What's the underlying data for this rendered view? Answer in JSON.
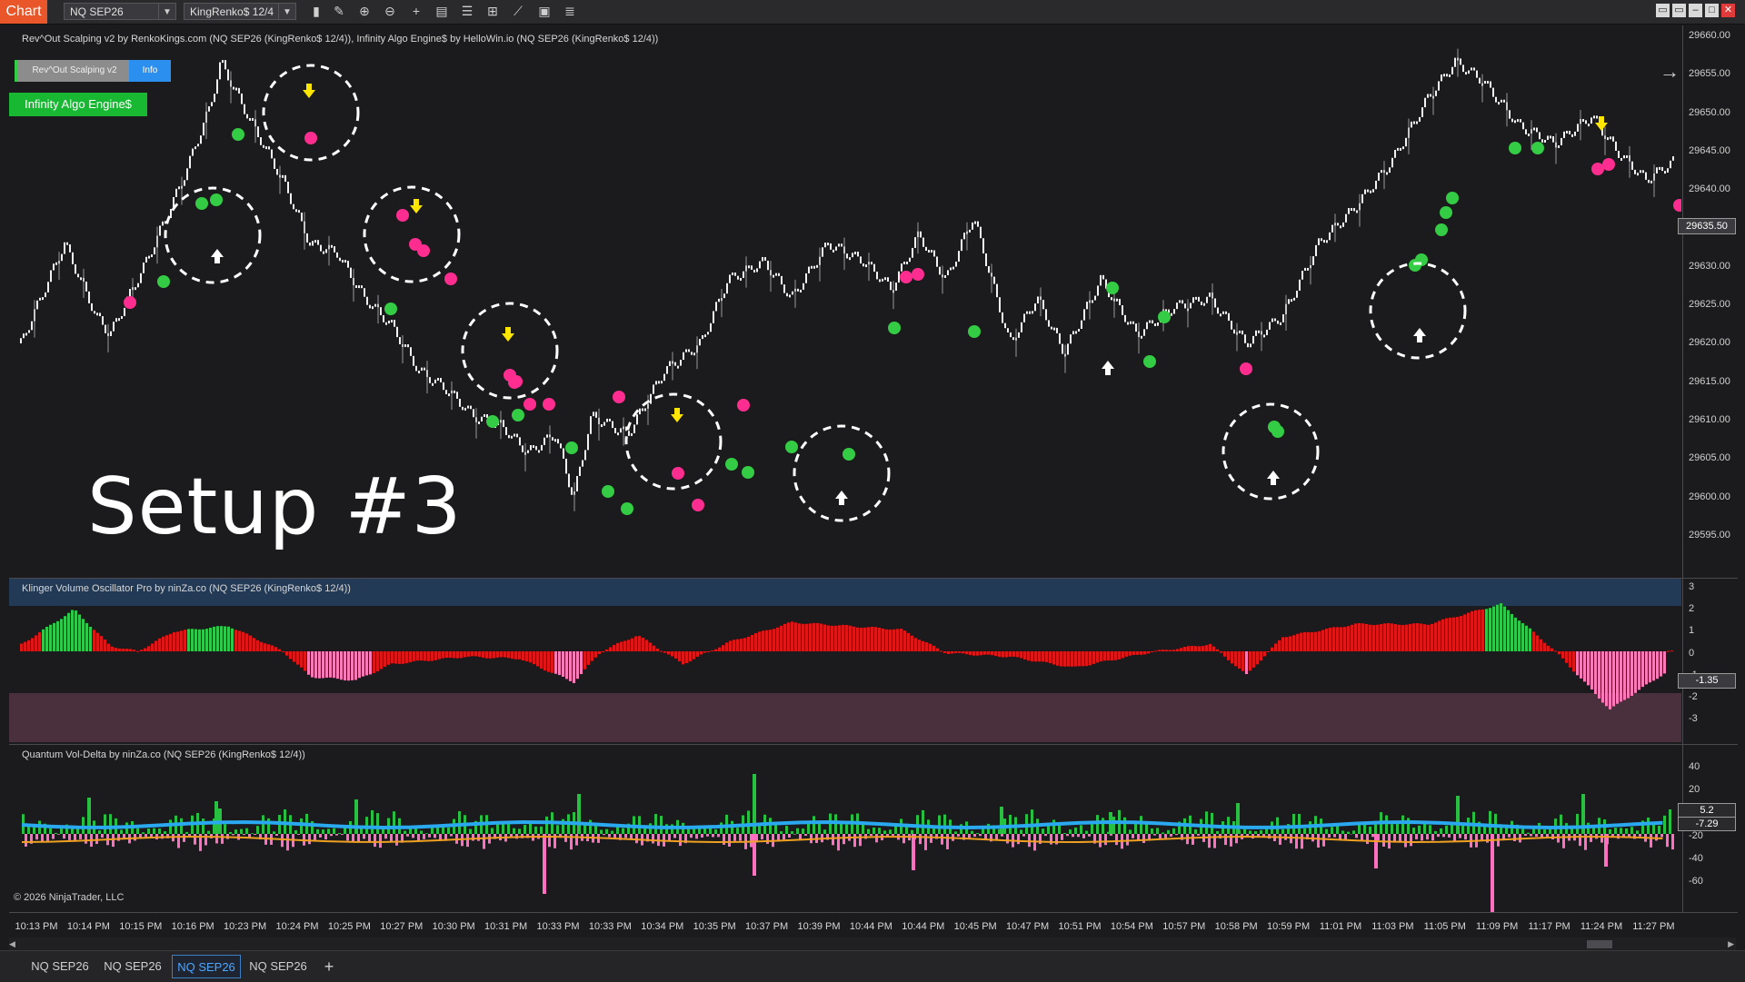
{
  "toolbar": {
    "chart_tab": "Chart",
    "instrument": "NQ SEP26",
    "bar_type": "KingRenko$ 12/4",
    "tool_icons": [
      "bars-icon",
      "pencil-icon",
      "zoom-in-icon",
      "zoom-out-icon",
      "crosshair-icon",
      "properties-icon",
      "templates-icon",
      "strategies-icon",
      "drawing-tools-icon",
      "data-box-icon",
      "object-list-icon"
    ],
    "window_buttons": [
      "tile-icon",
      "restore-icon",
      "minimize-icon",
      "maximize-icon",
      "close-icon"
    ]
  },
  "price_panel": {
    "title": "Rev^Out Scalping v2 by RenkoKings.com (NQ SEP26 (KingRenko$ 12/4)), Infinity Algo Engine$ by HelloWin.io (NQ SEP26 (KingRenko$ 12/4))",
    "rev_button": "Rev^Out Scalping v2",
    "info_button": "Info",
    "engine_button": "Infinity Algo Engine$",
    "setup_label": "Setup #3",
    "axis_labels": [
      "29660.00",
      "29655.00",
      "29650.00",
      "29645.00",
      "29640.00",
      "29635.00",
      "29630.00",
      "29625.00",
      "29620.00",
      "29615.00",
      "29610.00",
      "29605.00",
      "29600.00",
      "29595.00"
    ],
    "last_price": "29635.50"
  },
  "kvo_panel": {
    "title": "Klinger Volume Oscillator Pro by ninZa.co (NQ SEP26 (KingRenko$ 12/4))",
    "axis_labels": [
      "3",
      "2",
      "1",
      "0",
      "-1",
      "-2",
      "-3"
    ],
    "current_value": "-1.35"
  },
  "qvd_panel": {
    "title": "Quantum Vol-Delta by ninZa.co (NQ SEP26 (KingRenko$ 12/4))",
    "axis_labels": [
      "40",
      "20",
      "0",
      "-20",
      "-40",
      "-60"
    ],
    "value_a": "5.2",
    "value_b": "-7.29",
    "copyright": "© 2026 NinjaTrader, LLC"
  },
  "time_axis": [
    "10:13 PM",
    "10:14 PM",
    "10:15 PM",
    "10:16 PM",
    "10:23 PM",
    "10:24 PM",
    "10:25 PM",
    "10:27 PM",
    "10:30 PM",
    "10:31 PM",
    "10:33 PM",
    "10:33 PM",
    "10:34 PM",
    "10:35 PM",
    "10:37 PM",
    "10:39 PM",
    "10:44 PM",
    "10:44 PM",
    "10:45 PM",
    "10:47 PM",
    "10:51 PM",
    "10:54 PM",
    "10:57 PM",
    "10:58 PM",
    "10:59 PM",
    "11:01 PM",
    "11:03 PM",
    "11:05 PM",
    "11:09 PM",
    "11:17 PM",
    "11:24 PM",
    "11:27 PM"
  ],
  "bottom_tabs": [
    {
      "label": "NQ SEP26",
      "active": false
    },
    {
      "label": "NQ SEP26",
      "active": false
    },
    {
      "label": "NQ SEP26",
      "active": true
    },
    {
      "label": "NQ SEP26",
      "active": false
    }
  ],
  "add_tab": "+",
  "colors": {
    "chart_tab": "#e8562a",
    "bull_signal": "#33cc44",
    "bear_signal": "#ff2d8f",
    "arrow_up": "#ffffff",
    "arrow_down": "#ffe600",
    "kvo_positive_strong": "#2ec94a",
    "kvo_positive": "#e01515",
    "kvo_negative_strong": "#ff7ab8",
    "active_tab": "#4ea7ff"
  }
}
